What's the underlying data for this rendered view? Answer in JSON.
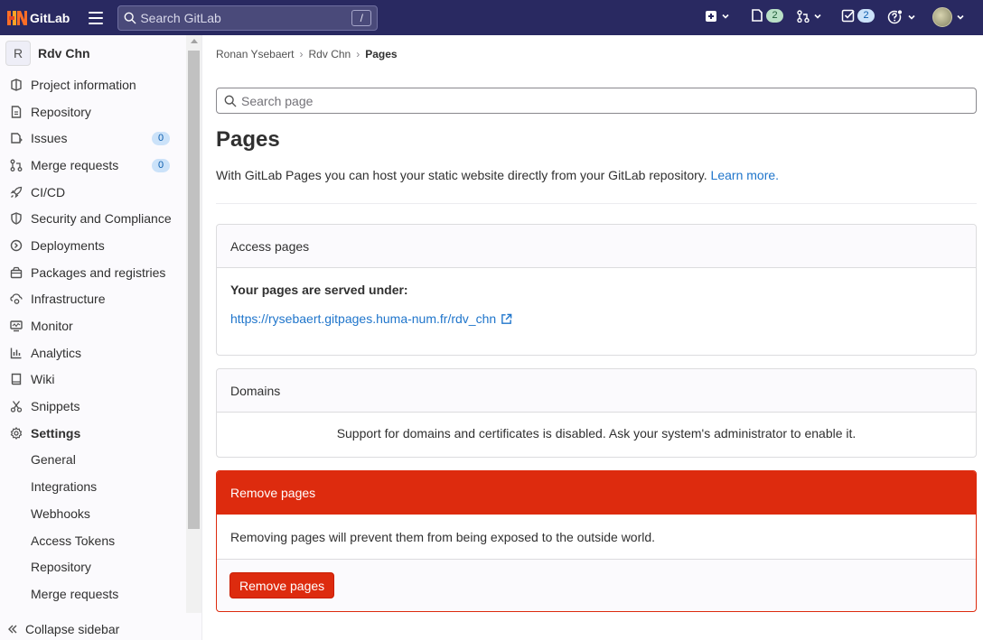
{
  "topbar": {
    "brand": "GitLab",
    "search_placeholder": "Search GitLab",
    "search_shortcut": "/",
    "issues_count": "2",
    "todos_count": "2",
    "colors": {
      "bg": "#292961",
      "accent": "#fc6d26"
    }
  },
  "sidebar": {
    "project_initial": "R",
    "project_name": "Rdv Chn",
    "items": [
      {
        "label": "Project information",
        "icon": "project-icon"
      },
      {
        "label": "Repository",
        "icon": "document-icon"
      },
      {
        "label": "Issues",
        "icon": "issues-icon",
        "badge": "0"
      },
      {
        "label": "Merge requests",
        "icon": "merge-request-icon",
        "badge": "0"
      },
      {
        "label": "CI/CD",
        "icon": "rocket-icon"
      },
      {
        "label": "Security and Compliance",
        "icon": "shield-icon"
      },
      {
        "label": "Deployments",
        "icon": "deployments-icon"
      },
      {
        "label": "Packages and registries",
        "icon": "package-icon"
      },
      {
        "label": "Infrastructure",
        "icon": "cloud-gear-icon"
      },
      {
        "label": "Monitor",
        "icon": "monitor-icon"
      },
      {
        "label": "Analytics",
        "icon": "chart-icon"
      },
      {
        "label": "Wiki",
        "icon": "book-icon"
      },
      {
        "label": "Snippets",
        "icon": "snippet-icon"
      },
      {
        "label": "Settings",
        "icon": "settings-icon"
      }
    ],
    "settings_sub": [
      "General",
      "Integrations",
      "Webhooks",
      "Access Tokens",
      "Repository",
      "Merge requests"
    ],
    "collapse_label": "Collapse sidebar"
  },
  "breadcrumb": [
    "Ronan Ysebaert",
    "Rdv Chn",
    "Pages"
  ],
  "page_search_placeholder": "Search page",
  "page": {
    "title": "Pages",
    "description": "With GitLab Pages you can host your static website directly from your GitLab repository.",
    "learn_more": "Learn more."
  },
  "access_card": {
    "title": "Access pages",
    "served_label": "Your pages are served under:",
    "url": "https://rysebaert.gitpages.huma-num.fr/rdv_chn"
  },
  "domains_card": {
    "title": "Domains",
    "message": "Support for domains and certificates is disabled. Ask your system's administrator to enable it."
  },
  "danger_card": {
    "title": "Remove pages",
    "message": "Removing pages will prevent them from being exposed to the outside world.",
    "button": "Remove pages",
    "color": "#dd2b0e"
  }
}
